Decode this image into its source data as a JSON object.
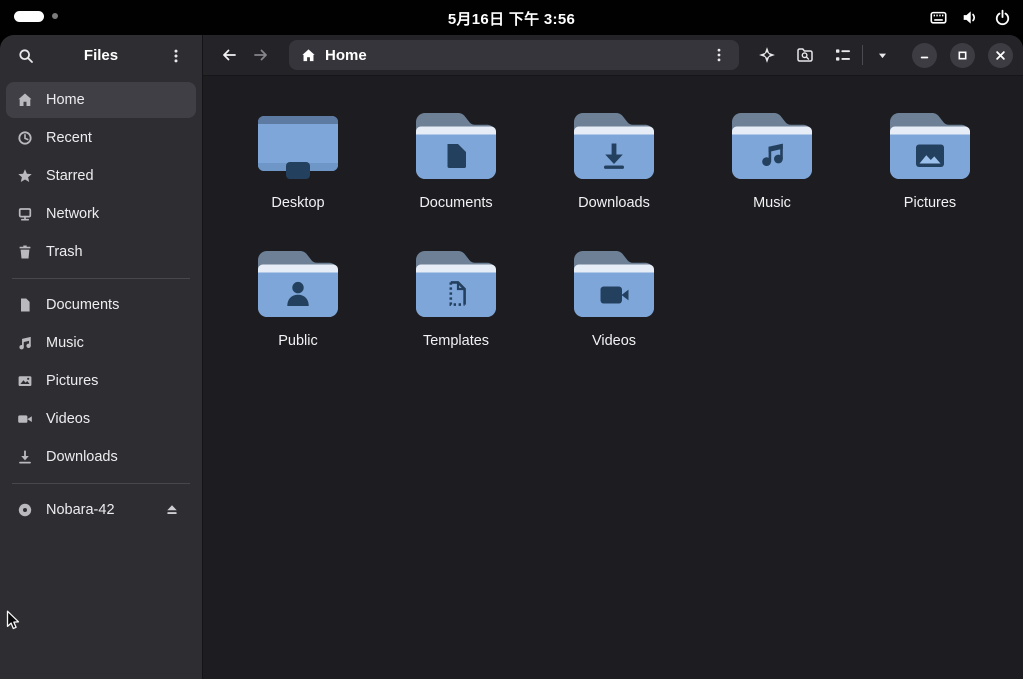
{
  "top_bar": {
    "clock_text": "5月16日 下午 3:56",
    "workspaces": {
      "active": 1,
      "total": 2
    },
    "status_icons": [
      "keyboard-icon",
      "volume-icon",
      "power-icon"
    ]
  },
  "files_app": {
    "sidebar": {
      "app_title": "Files",
      "header_icons": [
        "search-icon",
        "kebab-menu-icon"
      ],
      "sections": [
        {
          "items": [
            {
              "id": "home",
              "label": "Home",
              "icon": "home-icon",
              "selected": true
            },
            {
              "id": "recent",
              "label": "Recent",
              "icon": "clock-icon"
            },
            {
              "id": "starred",
              "label": "Starred",
              "icon": "star-icon"
            },
            {
              "id": "network",
              "label": "Network",
              "icon": "network-icon"
            },
            {
              "id": "trash",
              "label": "Trash",
              "icon": "trash-icon"
            }
          ]
        },
        {
          "items": [
            {
              "id": "documents",
              "label": "Documents",
              "icon": "document-icon"
            },
            {
              "id": "music",
              "label": "Music",
              "icon": "music-note-icon"
            },
            {
              "id": "pictures",
              "label": "Pictures",
              "icon": "image-icon"
            },
            {
              "id": "videos",
              "label": "Videos",
              "icon": "video-camera-icon"
            },
            {
              "id": "downloads",
              "label": "Downloads",
              "icon": "download-icon"
            }
          ]
        },
        {
          "items": [
            {
              "id": "nobara-42",
              "label": "Nobara-42",
              "icon": "disc-icon",
              "eject": true
            }
          ]
        }
      ]
    },
    "headerbar": {
      "location": "Home",
      "icons": [
        "back-arrow-icon",
        "forward-arrow-icon",
        "home-icon",
        "kebab-menu-icon",
        "search-everywhere-icon",
        "search-folder-icon",
        "view-list-icon",
        "chevron-down-icon",
        "minimize-icon",
        "maximize-icon",
        "close-icon"
      ]
    },
    "content": {
      "folders": [
        {
          "name": "Desktop",
          "glyph": "desktop-icon"
        },
        {
          "name": "Documents",
          "glyph": "document-glyph"
        },
        {
          "name": "Downloads",
          "glyph": "download-glyph"
        },
        {
          "name": "Music",
          "glyph": "music-glyph"
        },
        {
          "name": "Pictures",
          "glyph": "image-glyph"
        },
        {
          "name": "Public",
          "glyph": "person-glyph"
        },
        {
          "name": "Templates",
          "glyph": "template-glyph"
        },
        {
          "name": "Videos",
          "glyph": "video-glyph"
        }
      ]
    }
  },
  "colors": {
    "topbar_bg": "#010101",
    "sidebar_bg": "#2e2e32",
    "sidebar_selected": "#3f3f45",
    "headerbar_bg": "#232328",
    "content_bg": "#1d1d21",
    "folder_body": "#7ea6d8",
    "folder_tab": "#6d8096",
    "folder_paper": "#e7edf6",
    "folder_emblem": "#24405f",
    "desktop_top_band": "#5d7aa2",
    "image_mountain": "#9cc0ec"
  }
}
